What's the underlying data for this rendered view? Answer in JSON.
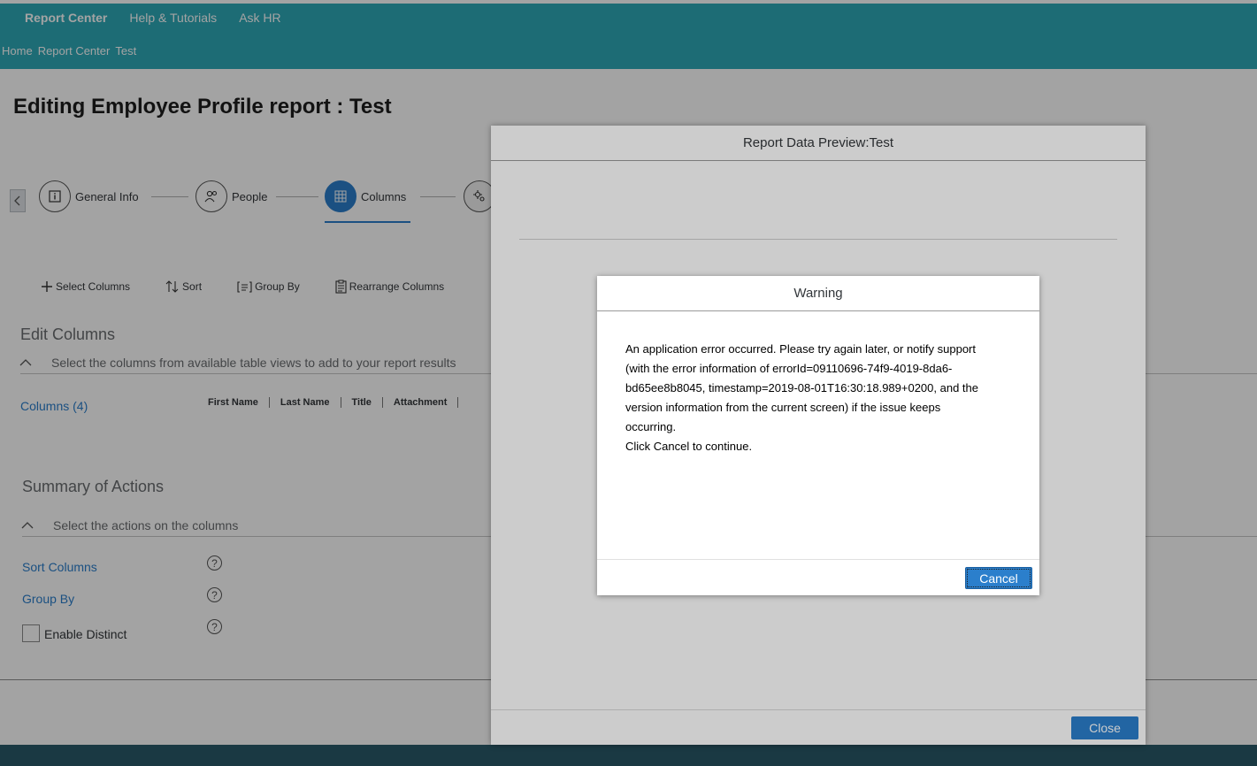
{
  "shell": {
    "nav": [
      "Report Center",
      "Help & Tutorials",
      "Ask HR"
    ],
    "breadcrumb": [
      "Home",
      "Report Center",
      "Test"
    ]
  },
  "page": {
    "title": "Editing Employee Profile report : Test"
  },
  "wizard": {
    "steps": [
      {
        "label": "General Info",
        "icon": "info-icon"
      },
      {
        "label": "People",
        "icon": "people-icon"
      },
      {
        "label": "Columns",
        "icon": "table-icon",
        "current": true
      },
      {
        "label": "",
        "icon": "gear-icon"
      }
    ]
  },
  "toolbar": {
    "select_columns": "Select Columns",
    "sort": "Sort",
    "group_by": "Group By",
    "rearrange_columns": "Rearrange Columns"
  },
  "edit_columns": {
    "title": "Edit Columns",
    "subtitle": "Select the columns from available table views to add to your report results",
    "columns_link": "Columns (4)",
    "headers": [
      "First Name",
      "Last Name",
      "Title",
      "Attachment"
    ]
  },
  "summary": {
    "title": "Summary of Actions",
    "subtitle": "Select the actions on the columns",
    "sort_columns": "Sort Columns",
    "group_by": "Group By",
    "enable_distinct": "Enable Distinct",
    "help_glyph": "?"
  },
  "preview_dialog": {
    "title": "Report Data Preview:Test",
    "close_label": "Close"
  },
  "warning_dialog": {
    "title": "Warning",
    "message_lines": [
      "An application error occurred. Please try again later, or notify support",
      "(with the error information of errorId=09110696-74f9-4019-8da6-",
      "bd65ee8b8045, timestamp=2019-08-01T16:30:18.989+0200, and the",
      "version information from the current screen) if the issue keeps",
      "occurring.",
      "Click Cancel to continue."
    ],
    "cancel_label": "Cancel"
  },
  "colors": {
    "shell": "#2fa9b8",
    "accent": "#2b7fcc",
    "bottom_bar": "#2a5a6a"
  }
}
